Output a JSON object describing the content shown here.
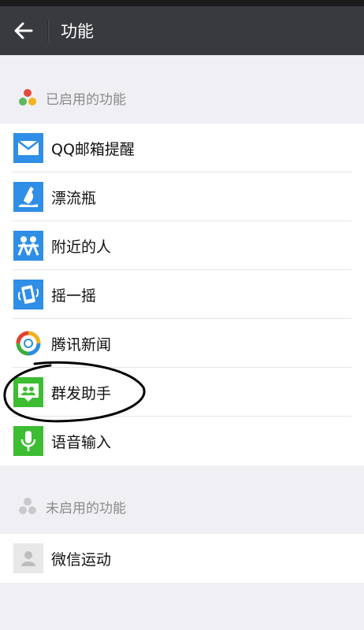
{
  "header": {
    "title": "功能"
  },
  "enabled": {
    "title": "已启用的功能",
    "items": [
      {
        "label": "QQ邮箱提醒",
        "icon": "mail-icon"
      },
      {
        "label": "漂流瓶",
        "icon": "bottle-icon"
      },
      {
        "label": "附近的人",
        "icon": "people-nearby-icon"
      },
      {
        "label": "摇一摇",
        "icon": "shake-icon"
      },
      {
        "label": "腾讯新闻",
        "icon": "tencent-news-icon"
      },
      {
        "label": "群发助手",
        "icon": "mass-message-icon"
      },
      {
        "label": "语音输入",
        "icon": "microphone-icon"
      }
    ]
  },
  "disabled": {
    "title": "未启用的功能",
    "items": [
      {
        "label": "微信运动",
        "icon": "wechat-sport-icon"
      }
    ]
  },
  "colors": {
    "topbar": "#393a3f",
    "blue_icon": "#2f8ee6",
    "green_icon": "#3cbd32",
    "background": "#efeff4"
  }
}
